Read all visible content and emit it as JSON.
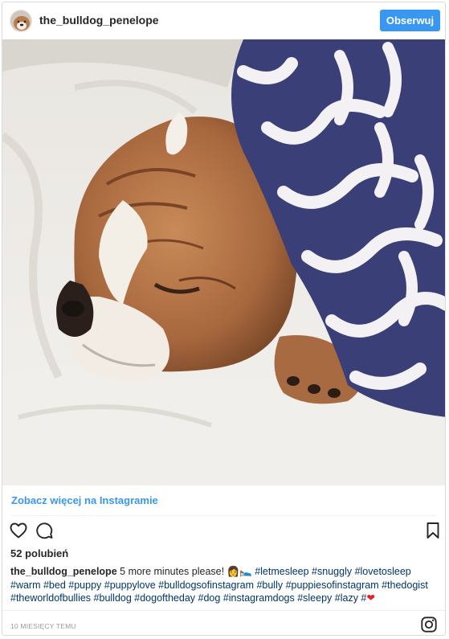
{
  "header": {
    "username": "the_bulldog_penelope",
    "follow_label": "Obserwuj"
  },
  "photo": {
    "icon": "image-photo",
    "subject": "sleeping-bulldog"
  },
  "see_more_label": "Zobacz więcej na Instagramie",
  "actions": {
    "like_icon": "heart-outline-icon",
    "comment_icon": "speech-bubble-icon",
    "save_icon": "bookmark-icon"
  },
  "likes_label": "52 polubień",
  "caption": {
    "username": "the_bulldog_penelope",
    "text": "5 more minutes please!",
    "emoji": "👩🛌",
    "hashtags": "#letmesleep #snuggly #lovetosleep #warm #bed #puppy #puppylove #bulldogsofinstagram #bully #puppiesofinstagram #thedogist #theworldofbullies #bulldog #dogoftheday #dog #instagramdogs #sleepy #lazy #",
    "heart": "❤"
  },
  "timestamp": "10 MIESIĘCY TEMU",
  "colors": {
    "accent": "#3897f0",
    "hashtag": "#003569",
    "heart": "#ed1c24"
  }
}
